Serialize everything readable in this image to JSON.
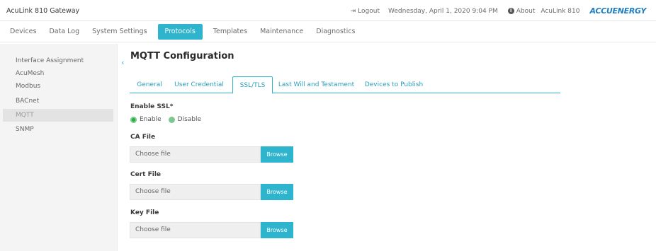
{
  "app": {
    "title": "AcuLink 810 Gateway",
    "logout_label": "Logout",
    "datetime": "Wednesday, April 1, 2020 9:04 PM",
    "about_label": "About",
    "device_name": "AcuLink 810",
    "brand_logo": "ACCUENERGY"
  },
  "nav": {
    "items": [
      {
        "label": "Devices"
      },
      {
        "label": "Data Log"
      },
      {
        "label": "System Settings"
      },
      {
        "label": "Protocols"
      },
      {
        "label": "Templates"
      },
      {
        "label": "Maintenance"
      },
      {
        "label": "Diagnostics"
      }
    ],
    "active": "Protocols"
  },
  "sidebar": {
    "items": [
      {
        "label": "Interface Assignment"
      },
      {
        "label": "AcuMesh"
      },
      {
        "label": "Modbus"
      },
      {
        "label": "BACnet"
      },
      {
        "label": "MQTT"
      },
      {
        "label": "SNMP"
      }
    ],
    "active": "MQTT"
  },
  "main": {
    "title": "MQTT Configuration",
    "tabs": [
      {
        "label": "General"
      },
      {
        "label": "User Credential"
      },
      {
        "label": "SSL/TLS"
      },
      {
        "label": "Last Will and Testament"
      },
      {
        "label": "Devices to Publish"
      }
    ],
    "active_tab": "SSL/TLS",
    "ssl": {
      "label": "Enable SSL*",
      "options": [
        {
          "label": "Enable"
        },
        {
          "label": "Disable"
        }
      ],
      "selected": "Enable"
    },
    "ca_file": {
      "label": "CA File",
      "placeholder": "Choose file",
      "button": "Browse"
    },
    "cert_file": {
      "label": "Cert File",
      "placeholder": "Choose file",
      "button": "Browse"
    },
    "key_file": {
      "label": "Key File",
      "placeholder": "Choose file",
      "button": "Browse"
    }
  },
  "colors": {
    "accent": "#2fb4cd",
    "radio_green": "#2aa845",
    "brand_blue": "#1f7fc1"
  }
}
